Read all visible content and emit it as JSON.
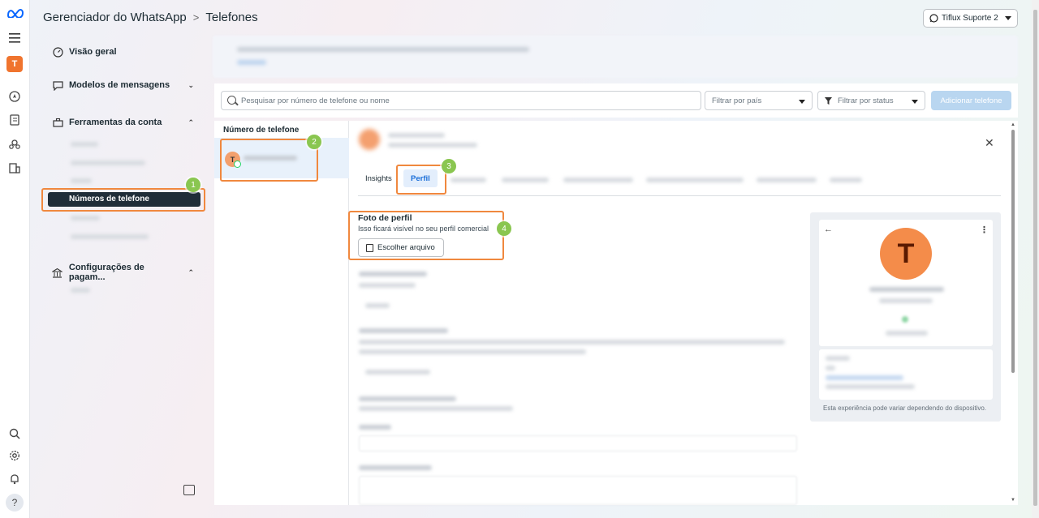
{
  "header": {
    "app": "Gerenciador do WhatsApp",
    "separator": ">",
    "page": "Telefones",
    "account": "Tiflux Suporte 2"
  },
  "rail": {
    "avatar_letter": "T"
  },
  "nav": {
    "overview": "Visão geral",
    "templates": "Modelos de mensagens",
    "tools": "Ferramentas da conta",
    "phones": "Números de telefone",
    "payments": "Configurações de pagam..."
  },
  "toolbar": {
    "search_placeholder": "Pesquisar por número de telefone ou nome",
    "country_filter": "Filtrar por país",
    "status_filter": "Filtrar por status",
    "add_phone": "Adicionar telefone"
  },
  "list": {
    "header": "Número de telefone",
    "avatar_letter": "T"
  },
  "detail": {
    "tabs": {
      "insights": "Insights",
      "profile": "Perfil"
    },
    "photo_title": "Foto de perfil",
    "photo_sub": "Isso ficará visível no seu perfil comercial",
    "choose_file": "Escolher arquivo",
    "preview_letter": "T",
    "preview_note": "Esta experiência pode variar dependendo do dispositivo."
  },
  "callouts": [
    "1",
    "2",
    "3",
    "4"
  ],
  "colors": {
    "highlight": "#f0883e",
    "badge": "#8ac650",
    "brand_avatar": "#f48c4a"
  }
}
